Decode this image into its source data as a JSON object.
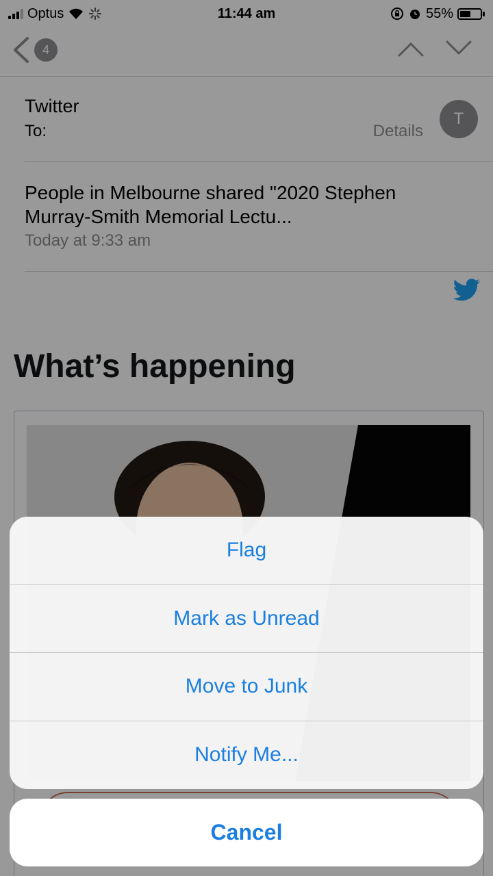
{
  "status_bar": {
    "carrier": "Optus",
    "time": "11:44 am",
    "battery_percent": "55%",
    "battery_level": 0.55
  },
  "nav": {
    "back_count": "4"
  },
  "email": {
    "sender": "Twitter",
    "to_label": "To:",
    "details_label": "Details",
    "avatar_initial": "T",
    "subject": "People in Melbourne shared \"2020 Stephen Murray-Smith Memorial Lectu...",
    "timestamp": "Today at 9:33 am",
    "body_heading": "What’s happening"
  },
  "action_sheet": {
    "items": [
      {
        "label": "Flag"
      },
      {
        "label": "Mark as Unread"
      },
      {
        "label": "Move to Junk"
      },
      {
        "label": "Notify Me..."
      }
    ],
    "cancel_label": "Cancel"
  },
  "colors": {
    "accent": "#1a7fe0",
    "twitter_blue": "#1da1f2",
    "secondary_text": "#8e8e93"
  },
  "icons": {
    "back": "chevron-left-icon",
    "previous": "chevron-up-icon",
    "next": "chevron-down-icon",
    "wifi": "wifi-icon",
    "activity": "activity-spinner-icon",
    "rotation_lock": "rotation-lock-icon",
    "alarm": "alarm-icon",
    "battery": "battery-icon",
    "twitter": "twitter-bird-icon"
  }
}
